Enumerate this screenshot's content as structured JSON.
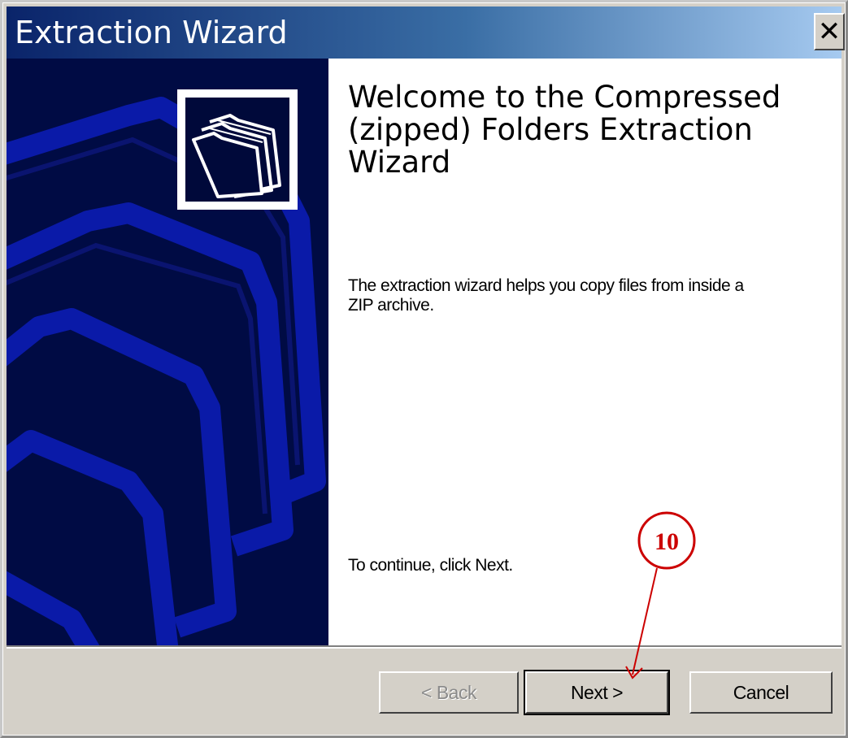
{
  "window": {
    "title": "Extraction Wizard",
    "close_label": "✕"
  },
  "content": {
    "heading": "Welcome to the Compressed (zipped) Folders Extraction Wizard",
    "description": "The extraction wizard helps you copy files from inside a ZIP archive.",
    "continue_hint": "To continue, click Next."
  },
  "buttons": {
    "back": "< Back",
    "next": "Next >",
    "cancel": "Cancel"
  },
  "annotation": {
    "step_number": "10"
  },
  "colors": {
    "side_panel": "#000b44",
    "folder_outline": "#0a1aa8",
    "callout": "#cc0000"
  }
}
